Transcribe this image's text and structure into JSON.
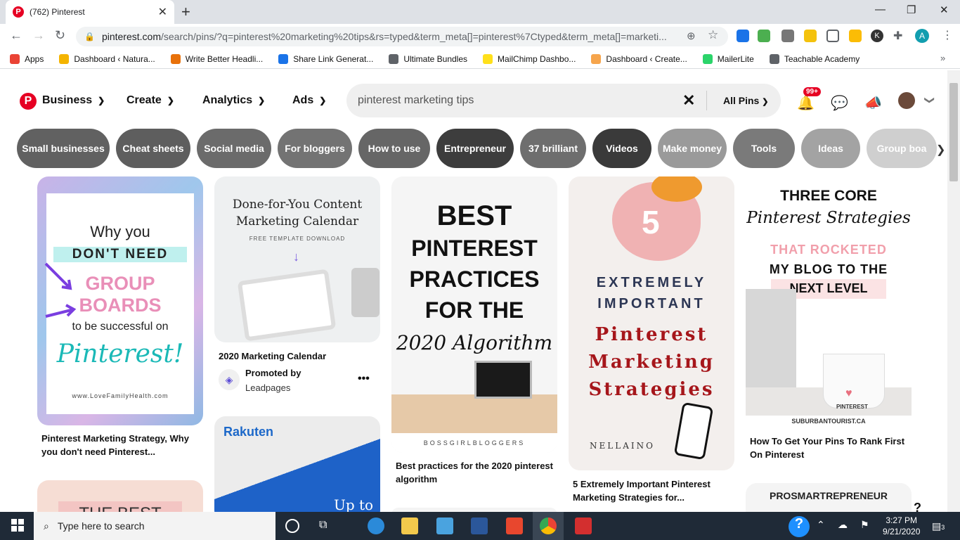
{
  "browser": {
    "tab_title": "(762) Pinterest",
    "url_host": "pinterest.com",
    "url_rest": "/search/pins/?q=pinterest%20marketing%20tips&rs=typed&term_meta[]=pinterest%7Ctyped&term_meta[]=marketi...",
    "bookmarks": [
      "Apps",
      "Dashboard ‹ Natura...",
      "Write Better Headli...",
      "Share Link Generat...",
      "Ultimate Bundles",
      "MailChimp Dashbo...",
      "Dashboard ‹ Create...",
      "MailerLite",
      "Teachable Academy"
    ],
    "bookmark_colors": [
      "#ea4335",
      "#f4b400",
      "#e8710a",
      "#1a73e8",
      "#5f6368",
      "#ffe01b",
      "#f6a54c",
      "#2bd46a",
      "#5f6368"
    ],
    "ext_avatar_letter": "A",
    "ext_k_letter": "K"
  },
  "header": {
    "menus": [
      "Business",
      "Create",
      "Analytics",
      "Ads"
    ],
    "search_value": "pinterest marketing tips",
    "scope_label": "All Pins",
    "notif_badge": "99+"
  },
  "chips": [
    {
      "label": "Small businesses",
      "color": "#616161"
    },
    {
      "label": "Cheat sheets",
      "color": "#5e5e5e"
    },
    {
      "label": "Social media",
      "color": "#6b6b6b"
    },
    {
      "label": "For bloggers",
      "color": "#737373"
    },
    {
      "label": "How to use",
      "color": "#666666"
    },
    {
      "label": "Entrepreneur",
      "color": "#3d3d3d"
    },
    {
      "label": "37 brilliant",
      "color": "#6e6e6e"
    },
    {
      "label": "Videos",
      "color": "#3a3a3a"
    },
    {
      "label": "Make money",
      "color": "#9a9a9a"
    },
    {
      "label": "Tools",
      "color": "#7a7a7a"
    },
    {
      "label": "Ideas",
      "color": "#a3a3a3"
    },
    {
      "label": "Group boa",
      "color": "#cfcfcf"
    }
  ],
  "pins": {
    "p1": {
      "l1": "Why you",
      "l2": "DON'T NEED",
      "l3": "GROUP",
      "l4": "BOARDS",
      "l5": "to be successful on",
      "l6": "Pinterest!",
      "site": "www.LoveFamilyHealth.com",
      "caption": "Pinterest Marketing Strategy, Why you don't need Pinterest..."
    },
    "p2": {
      "l1": "Done-for-You Content",
      "l2": "Marketing Calendar",
      "l3": "FREE TEMPLATE DOWNLOAD",
      "caption": "2020 Marketing Calendar",
      "promoted": "Promoted by",
      "advertiser": "Leadpages"
    },
    "p3": {
      "l1": "BEST",
      "l2": "PINTEREST",
      "l3": "PRACTICES",
      "l4": "FOR THE",
      "l5": "2020 Algorithm",
      "site": "BOSSGIRLBLOGGERS",
      "caption": "Best practices for the 2020 pinterest algorithm"
    },
    "p4": {
      "num": "5",
      "l1": "EXTREMELY",
      "l2": "IMPORTANT",
      "l3": "Pinterest",
      "l4": "Marketing",
      "l5": "Strategies",
      "brand": "NELLAINO",
      "caption": "5 Extremely Important Pinterest Marketing Strategies for..."
    },
    "p5": {
      "l1": "THREE CORE",
      "l2": "Pinterest Strategies",
      "l3": "THAT ROCKETED",
      "l4": "MY BLOG TO THE",
      "l5": "NEXT LEVEL",
      "mug": "PINTEREST",
      "site": "SUBURBANTOURIST.CA",
      "caption": "How To Get Your Pins To Rank First On Pinterest"
    },
    "p6": {
      "l1": "THE BEST"
    },
    "p7": {
      "brand": "Rakuten",
      "l1": "Up to"
    },
    "p8": {
      "l1": "PROSMARTREPRENEUR"
    }
  },
  "taskbar": {
    "search_placeholder": "Type here to search",
    "time": "3:27 PM",
    "date": "9/21/2020",
    "notif_count": "3"
  }
}
